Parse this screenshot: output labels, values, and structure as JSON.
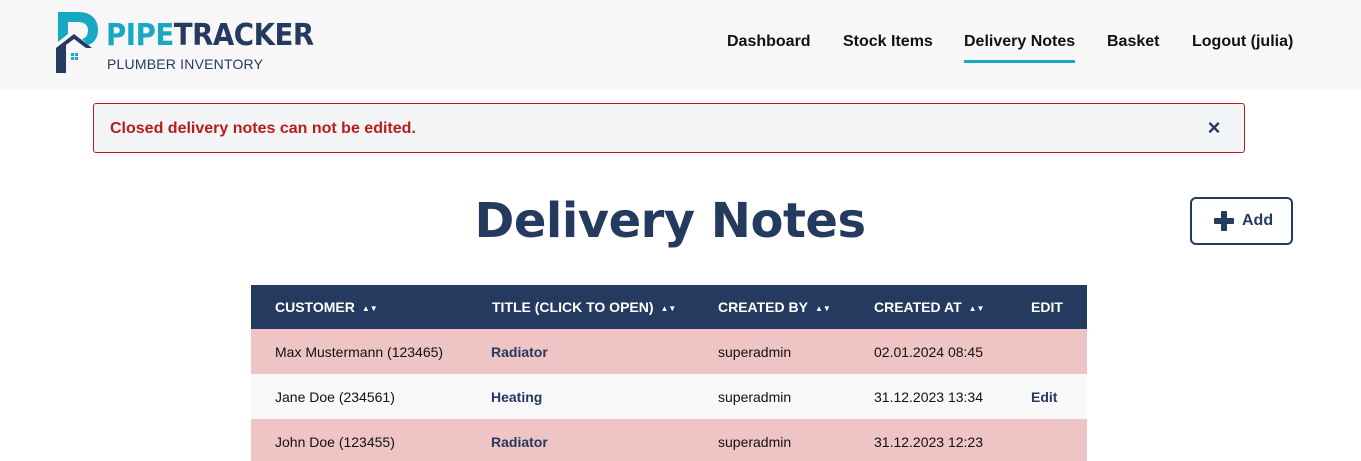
{
  "brand": {
    "name_part1": "PIPE",
    "name_part2": "TRACKER",
    "tagline": "PLUMBER INVENTORY"
  },
  "nav": {
    "dashboard": "Dashboard",
    "stock_items": "Stock Items",
    "delivery_notes": "Delivery Notes",
    "basket": "Basket",
    "logout": "Logout (julia)",
    "active": "delivery_notes"
  },
  "alert": {
    "message": "Closed delivery notes can not be edited.",
    "close_symbol": "×"
  },
  "page": {
    "title": "Delivery Notes",
    "add_label": "Add"
  },
  "table": {
    "columns": [
      "CUSTOMER",
      "TITLE (CLICK TO OPEN)",
      "CREATED BY",
      "CREATED AT",
      "EDIT"
    ],
    "sort_symbol": "▲▼",
    "rows": [
      {
        "customer": "Max Mustermann (123465)",
        "title": "Radiator",
        "created_by": "superadmin",
        "created_at": "02.01.2024 08:45",
        "edit": "",
        "status": "closed"
      },
      {
        "customer": "Jane Doe (234561)",
        "title": "Heating",
        "created_by": "superadmin",
        "created_at": "31.12.2023 13:34",
        "edit": "Edit",
        "status": "open"
      },
      {
        "customer": "John Doe (123455)",
        "title": "Radiator",
        "created_by": "superadmin",
        "created_at": "31.12.2023 12:23",
        "edit": "",
        "status": "closed"
      }
    ]
  },
  "colors": {
    "navy": "#243a5e",
    "cyan": "#17a9c4",
    "error_red": "#b91c1c",
    "closed_row": "#efc4c4"
  },
  "icons": {
    "logo": "house-pipe-logo-icon",
    "close": "close-icon",
    "add": "plus-icon",
    "sort": "sort-icon"
  }
}
